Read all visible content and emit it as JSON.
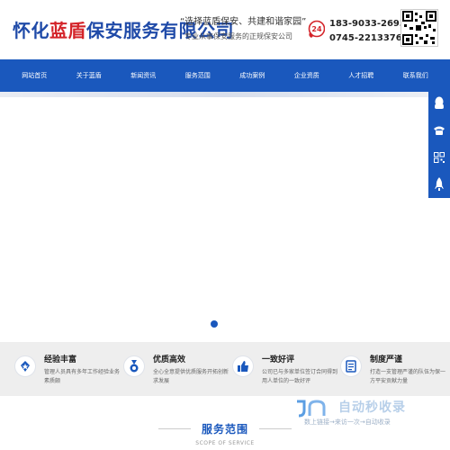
{
  "header": {
    "logo_prefix": "怀化",
    "logo_highlight": "蓝盾",
    "logo_suffix": "保安服务有限公司",
    "slogan_main": "“选择蓝盾保安、共建和谐家园”",
    "slogan_sub": "专业从事保安服务的正规保安公司",
    "phone_icon_label": "24",
    "phone_1": "183-9033-2693",
    "phone_2": "0745-2213376"
  },
  "nav": {
    "items": [
      "网站首页",
      "关于蓝盾",
      "新闻资讯",
      "服务范围",
      "成功案例",
      "企业资质",
      "人才招聘",
      "联系我们"
    ]
  },
  "features": [
    {
      "icon": "lightbulb-icon",
      "title": "经验丰富",
      "desc": "管理人员具有多年工作经验业务素质颇"
    },
    {
      "icon": "medal-icon",
      "title": "优质高效",
      "desc": "全心全意提供优质服务开拓创新求发展"
    },
    {
      "icon": "thumbs-up-icon",
      "title": "一致好评",
      "desc": "公司已与多家单位签订合同得到用人单位的一致好评"
    },
    {
      "icon": "document-icon",
      "title": "制度严谨",
      "desc": "打造一支管理严谨的队伍为保一方平安贡献力量"
    }
  ],
  "section": {
    "title": "服务范围",
    "subtitle": "SCOPE OF SERVICE"
  },
  "watermark": {
    "text": "自动秒收录",
    "sub": "数上链接→来访一次→自动收录"
  },
  "colors": {
    "brand_blue": "#1a58bd",
    "logo_blue": "#1f4aa8",
    "accent_red": "#d4242a"
  }
}
